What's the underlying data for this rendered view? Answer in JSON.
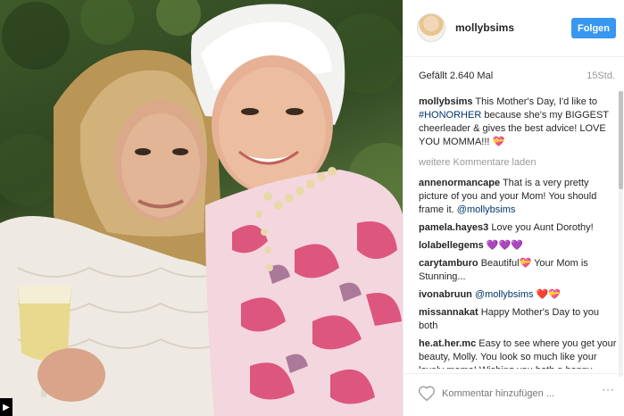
{
  "post": {
    "username": "mollybsims",
    "follow_label": "Folgen",
    "likes": "Gefällt 2.640 Mal",
    "age": "15Std."
  },
  "caption": {
    "user": "mollybsims",
    "text_a": "This Mother's Day, I'd like to",
    "hashtag": "#HONORHER",
    "text_b": "because she's my BIGGEST cheerleader & gives the best advice! LOVE YOU MOMMA!!!",
    "emoji": "💝"
  },
  "more_comments_label": "weitere Kommentare laden",
  "comments": [
    {
      "user": "annenormancape",
      "text": "That is a very pretty picture of you and your Mom! You should frame it.",
      "mention": "@mollybsims"
    },
    {
      "user": "pamela.hayes3",
      "text": "Love you Aunt Dorothy!",
      "mention": ""
    },
    {
      "user": "lolabellegems",
      "text": "💜💜💜",
      "mention": ""
    },
    {
      "user": "carytamburo",
      "text": "Beautiful💝 Your Mom is Stunning...",
      "mention": ""
    },
    {
      "user": "ivonabruun",
      "text": "❤️💝",
      "mention": "@mollybsims"
    },
    {
      "user": "missannakat",
      "text": "Happy Mother's Day to you both",
      "mention": ""
    },
    {
      "user": "he.at.her.mc",
      "text": "Easy to see where you get your beauty, Molly. You look so much like your lovely mama! Wishing you both a happy Mother's Day!",
      "mention": ""
    }
  ],
  "footer": {
    "placeholder": "Kommentar hinzufügen ...",
    "more_icon": "⋯"
  },
  "icons": {
    "like": "heart-outline-icon",
    "avatar": "profile-avatar",
    "video": "video-corner-icon"
  },
  "colors": {
    "accent": "#3897f0",
    "link": "#003569",
    "muted": "#999999"
  }
}
